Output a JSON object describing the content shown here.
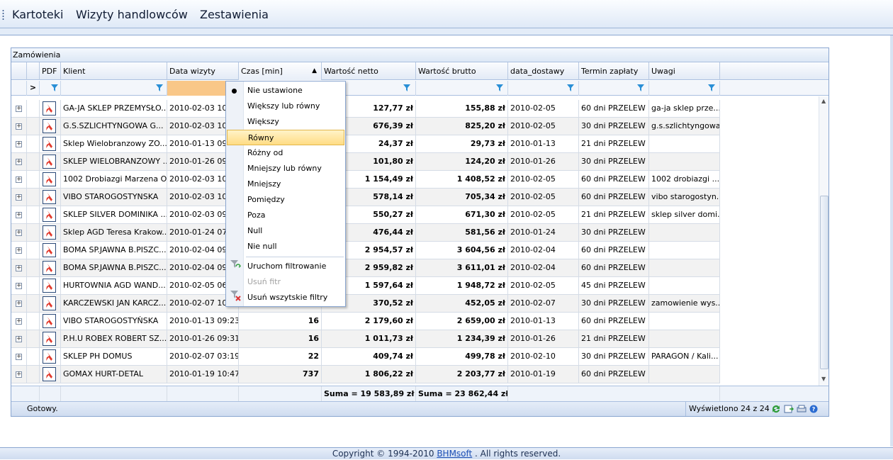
{
  "menu": [
    "Kartoteki",
    "Wizyty handlowców",
    "Zestawienia"
  ],
  "panel_title": "Zamówienia",
  "columns": [
    "PDF",
    "Klient",
    "Data wizyty",
    "Czas [min]",
    "Wartość netto",
    "Wartość brutto",
    "data_dostawy",
    "Termin zapłaty",
    "Uwagi"
  ],
  "sort_indicator": "▲",
  "filter_row_marker": ">",
  "rows": [
    {
      "klient": "GA-JA SKLEP PRZEMYSŁO...",
      "data": "2010-02-03 10:0",
      "czas": "",
      "netto": "127,77 zł",
      "brutto": "155,88 zł",
      "dostawa": "2010-02-05",
      "termin": "60 dni PRZELEW ...",
      "uwagi": "ga-ja sklep prze..."
    },
    {
      "klient": "G.S.SZLICHTYNGOWA G...",
      "data": "2010-02-03 10:1",
      "czas": "",
      "netto": "676,39 zł",
      "brutto": "825,20 zł",
      "dostawa": "2010-02-05",
      "termin": "30 dni PRZELEW ...",
      "uwagi": "g.s.szlichtyngowa"
    },
    {
      "klient": "Sklep Wielobranzowy ZO...",
      "data": "2010-01-13 09:1",
      "czas": "",
      "netto": "24,37 zł",
      "brutto": "29,73 zł",
      "dostawa": "2010-01-13",
      "termin": "21 dni PRZELEW ...",
      "uwagi": ""
    },
    {
      "klient": "SKLEP WIELOBRANZOWY ...",
      "data": "2010-01-26 09:2",
      "czas": "",
      "netto": "101,80 zł",
      "brutto": "124,20 zł",
      "dostawa": "2010-01-26",
      "termin": "30 dni PRZELEW ...",
      "uwagi": ""
    },
    {
      "klient": "1002 Drobiazgi Marzena O...",
      "data": "2010-02-03 10:1",
      "czas": "",
      "netto": "1 154,49 zł",
      "brutto": "1 408,52 zł",
      "dostawa": "2010-02-05",
      "termin": "60 dni PRZELEW ...",
      "uwagi": "1002 drobiazgi ..."
    },
    {
      "klient": "VIBO STAROGOSTYNSKA",
      "data": "2010-02-03 10:2",
      "czas": "",
      "netto": "578,14 zł",
      "brutto": "705,34 zł",
      "dostawa": "2010-02-05",
      "termin": "60 dni PRZELEW ...",
      "uwagi": "vibo starogostyn..."
    },
    {
      "klient": "SKLEP SILVER DOMINIKA ...",
      "data": "2010-02-03 09:5",
      "czas": "",
      "netto": "550,27 zł",
      "brutto": "671,30 zł",
      "dostawa": "2010-02-05",
      "termin": "21 dni PRZELEW ...",
      "uwagi": "sklep silver domi..."
    },
    {
      "klient": "Sklep AGD Teresa Krakow...",
      "data": "2010-01-24 07:3",
      "czas": "",
      "netto": "476,44 zł",
      "brutto": "581,56 zł",
      "dostawa": "2010-01-24",
      "termin": "30 dni PRZELEW ...",
      "uwagi": ""
    },
    {
      "klient": "BOMA SP.JAWNA B.PISZC...",
      "data": "2010-02-04 09:2",
      "czas": "",
      "netto": "2 954,57 zł",
      "brutto": "3 604,56 zł",
      "dostawa": "2010-02-04",
      "termin": "60 dni PRZELEW ...",
      "uwagi": ""
    },
    {
      "klient": "BOMA SP.JAWNA B.PISZC...",
      "data": "2010-02-04 09:2",
      "czas": "",
      "netto": "2 959,82 zł",
      "brutto": "3 611,01 zł",
      "dostawa": "2010-02-04",
      "termin": "60 dni PRZELEW ...",
      "uwagi": ""
    },
    {
      "klient": "HURTOWNIA AGD WAND...",
      "data": "2010-02-05 06:1",
      "czas": "",
      "netto": "1 597,64 zł",
      "brutto": "1 948,72 zł",
      "dostawa": "2010-02-05",
      "termin": "45 dni PRZELEW ...",
      "uwagi": ""
    },
    {
      "klient": "KARCZEWSKI JAN KARCZ...",
      "data": "2010-02-07 10:1",
      "czas": "",
      "netto": "370,52 zł",
      "brutto": "452,05 zł",
      "dostawa": "2010-02-07",
      "termin": "30 dni PRZELEW ...",
      "uwagi": "zamowienie wys..."
    },
    {
      "klient": "VIBO STAROGOSTYŃSKA",
      "data": "2010-01-13 09:23",
      "czas": "16",
      "netto": "2 179,60 zł",
      "brutto": "2 659,00 zł",
      "dostawa": "2010-01-13",
      "termin": "60 dni PRZELEW ...",
      "uwagi": ""
    },
    {
      "klient": "P.H.U ROBEX ROBERT SZ...",
      "data": "2010-01-26 09:31",
      "czas": "16",
      "netto": "1 011,73 zł",
      "brutto": "1 234,39 zł",
      "dostawa": "2010-01-26",
      "termin": "21 dni PRZELEW ...",
      "uwagi": ""
    },
    {
      "klient": "SKLEP PH DOMUS",
      "data": "2010-02-07 03:19",
      "czas": "22",
      "netto": "409,74 zł",
      "brutto": "499,78 zł",
      "dostawa": "2010-02-10",
      "termin": "30 dni PRZELEW ...",
      "uwagi": "PARAGON / Kali..."
    },
    {
      "klient": "GOMAX HURT-DETAL",
      "data": "2010-01-19 10:47",
      "czas": "737",
      "netto": "1 806,22 zł",
      "brutto": "2 203,77 zł",
      "dostawa": "2010-01-19",
      "termin": "60 dni PRZELEW ...",
      "uwagi": ""
    }
  ],
  "sums": {
    "netto": "Suma = 19 583,89 zł",
    "brutto": "Suma = 23 862,44 zł"
  },
  "status": {
    "left": "Gotowy.",
    "right": "Wyświetlono 24 z 24"
  },
  "dropdown": {
    "items": [
      "Nie ustawione",
      "Większy lub równy",
      "Większy",
      "Równy",
      "Różny od",
      "Mniejszy lub równy",
      "Mniejszy",
      "Pomiędzy",
      "Poza",
      "Null",
      "Nie null"
    ],
    "actions": [
      "Uruchom filtrowanie",
      "Usuń fitr",
      "Usuń wszytskie filtry"
    ],
    "selected_index": 3,
    "checked_index": 0
  },
  "footer": {
    "prefix": "Copyright © 1994-2010 ",
    "link": "BHMsoft",
    "suffix": " . All rights reserved."
  }
}
